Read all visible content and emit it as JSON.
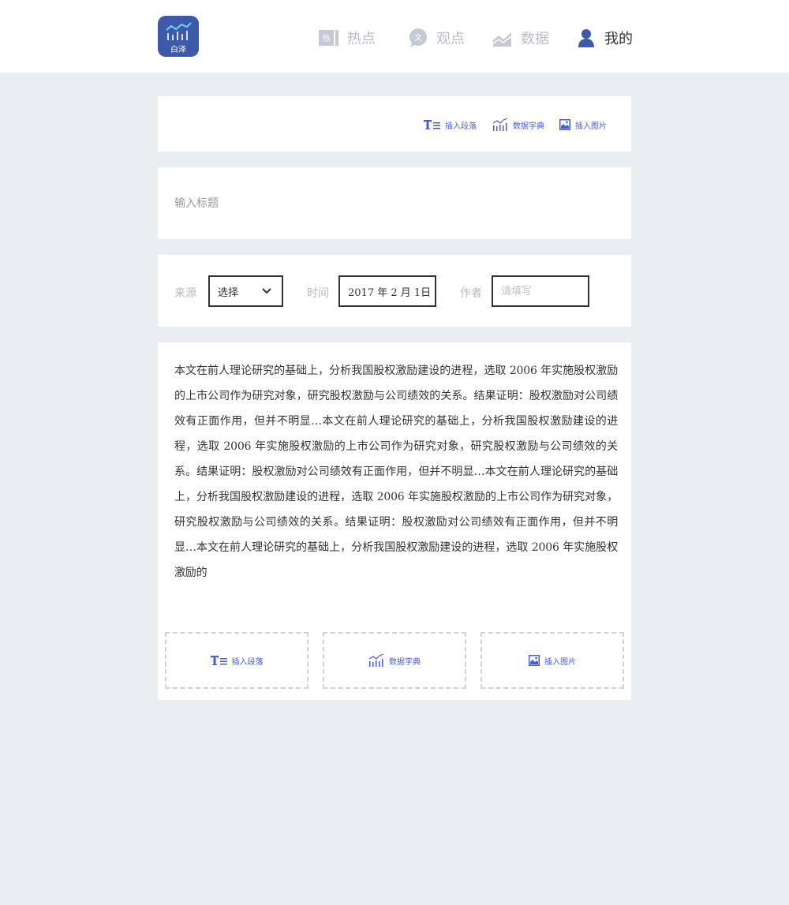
{
  "logo": {
    "text": "白泽",
    "bg_color": "#3c5aa8"
  },
  "nav": {
    "items": [
      {
        "label": "热点",
        "icon": "hot-icon",
        "active": false
      },
      {
        "label": "观点",
        "icon": "chat-icon",
        "active": false
      },
      {
        "label": "数据",
        "icon": "area-chart-icon",
        "active": false
      },
      {
        "label": "我的",
        "icon": "user-icon",
        "active": true
      }
    ],
    "inactive_color": "#b7bcc8",
    "active_color": "#333333"
  },
  "toolbar": {
    "insert_paragraph": "插入段落",
    "data_dictionary": "数据字典",
    "insert_image": "插入图片",
    "accent_color": "#4a5bd6"
  },
  "title_field": {
    "placeholder": "输入标题",
    "value": ""
  },
  "meta": {
    "source_label": "来源",
    "source_value": "选择",
    "time_label": "时间",
    "time_value": "2017 年 2 月 1日",
    "author_label": "作者",
    "author_placeholder": "请填写",
    "author_value": ""
  },
  "content": {
    "body": "本文在前人理论研究的基础上，分析我国股权激励建设的进程，选取 2006 年实施股权激励的上市公司作为研究对象，研究股权激励与公司绩效的关系。结果证明：股权激励对公司绩效有正面作用，但并不明显…本文在前人理论研究的基础上，分析我国股权激励建设的进程，选取 2006 年实施股权激励的上市公司作为研究对象，研究股权激励与公司绩效的关系。结果证明：股权激励对公司绩效有正面作用，但并不明显…本文在前人理论研究的基础上，分析我国股权激励建设的进程，选取 2006 年实施股权激励的上市公司作为研究对象，研究股权激励与公司绩效的关系。结果证明：股权激励对公司绩效有正面作用，但并不明显…本文在前人理论研究的基础上，分析我国股权激励建设的进程，选取 2006 年实施股权激励的"
  },
  "bottom_actions": {
    "insert_paragraph": "插入段落",
    "data_dictionary": "数据字典",
    "insert_image": "插入图片"
  }
}
